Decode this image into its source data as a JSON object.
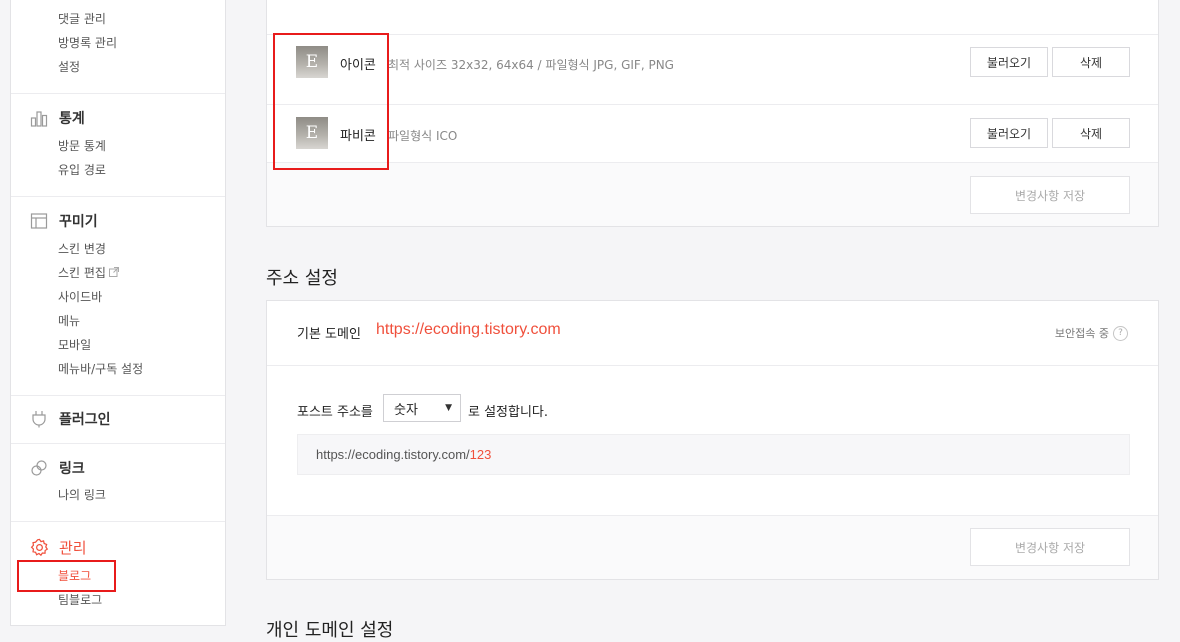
{
  "sidebar": {
    "top_items": [
      "댓글 관리",
      "방명록 관리",
      "설정"
    ],
    "stats": {
      "title": "통계",
      "items": [
        "방문 통계",
        "유입 경로"
      ],
      "icon": "bar-chart-icon"
    },
    "design": {
      "title": "꾸미기",
      "items": [
        "스킨 변경",
        "스킨 편집",
        "사이드바",
        "메뉴",
        "모바일",
        "메뉴바/구독 설정"
      ],
      "icon": "layout-icon"
    },
    "plugin": {
      "title": "플러그인",
      "icon": "plug-icon"
    },
    "link": {
      "title": "링크",
      "items": [
        "나의 링크"
      ],
      "icon": "link-icon"
    },
    "manage": {
      "title": "관리",
      "items": [
        "블로그",
        "팀블로그"
      ],
      "icon": "gear-icon",
      "active_color": "#f0503c"
    }
  },
  "icons_panel": {
    "icon_row": {
      "thumb": "E",
      "title": "아이콘",
      "desc": "최적 사이즈 32x32, 64x64 / 파일형식 JPG, GIF, PNG",
      "load": "불러오기",
      "delete": "삭제"
    },
    "favicon_row": {
      "thumb": "E",
      "title": "파비콘",
      "desc": "파일형식 ICO",
      "load": "불러오기",
      "delete": "삭제"
    },
    "save": "변경사항 저장"
  },
  "address": {
    "section_title": "주소 설정",
    "domain_label": "기본 도메인",
    "domain_url": "https://ecoding.tistory.com",
    "secure": "보안접속 중",
    "post_label": "포스트 주소를",
    "post_select": "숫자",
    "post_suffix": "로 설정합니다.",
    "preview_base": "https://ecoding.tistory.com/",
    "preview_num": "123",
    "save": "변경사항 저장"
  },
  "custom_domain": {
    "section_title": "개인 도메인 설정"
  },
  "colors": {
    "accent": "#f0503c",
    "highlight_box": "#e81b1b"
  }
}
